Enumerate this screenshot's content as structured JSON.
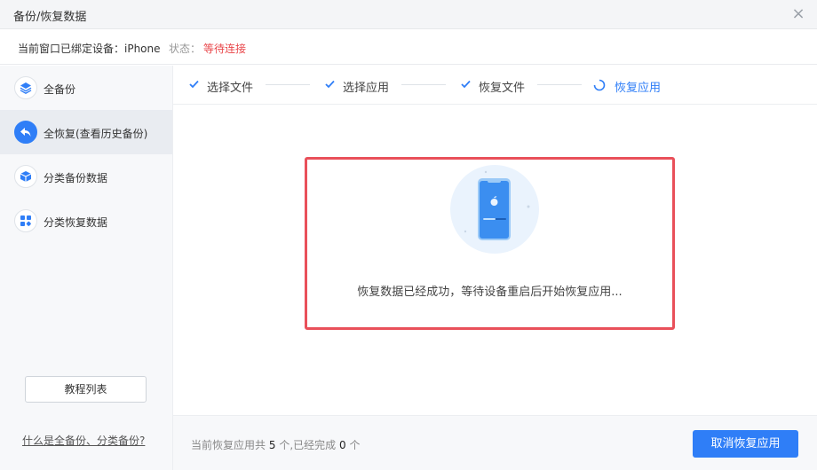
{
  "window": {
    "title": "备份/恢复数据",
    "close_icon": "close-icon"
  },
  "device": {
    "label": "当前窗口已绑定设备：iPhone",
    "status_label": "状态：",
    "status_value": "等待连接",
    "status_color": "#e9464a"
  },
  "sidebar": {
    "items": [
      {
        "label": "全备份",
        "icon": "layers-icon",
        "active": false
      },
      {
        "label": "全恢复(查看历史备份)",
        "icon": "undo-arrow-icon",
        "active": true
      },
      {
        "label": "分类备份数据",
        "icon": "cube-icon",
        "active": false
      },
      {
        "label": "分类恢复数据",
        "icon": "grid-icon",
        "active": false
      }
    ],
    "tutorial_button": "教程列表",
    "help_link": "什么是全备份、分类备份?"
  },
  "steps": [
    {
      "label": "选择文件",
      "state": "done"
    },
    {
      "label": "选择应用",
      "state": "done"
    },
    {
      "label": "恢复文件",
      "state": "done"
    },
    {
      "label": "恢复应用",
      "state": "in-progress"
    }
  ],
  "main": {
    "illustration": "phone-apple-icon",
    "message": "恢复数据已经成功，等待设备重启后开始恢复应用..."
  },
  "footer": {
    "prefix": "当前恢复应用共",
    "total": "5",
    "middle": "个,已经完成",
    "done": "0",
    "suffix": "个",
    "cancel_button": "取消恢复应用"
  },
  "colors": {
    "accent": "#2f7ef7",
    "highlight_border": "#e9505a"
  }
}
